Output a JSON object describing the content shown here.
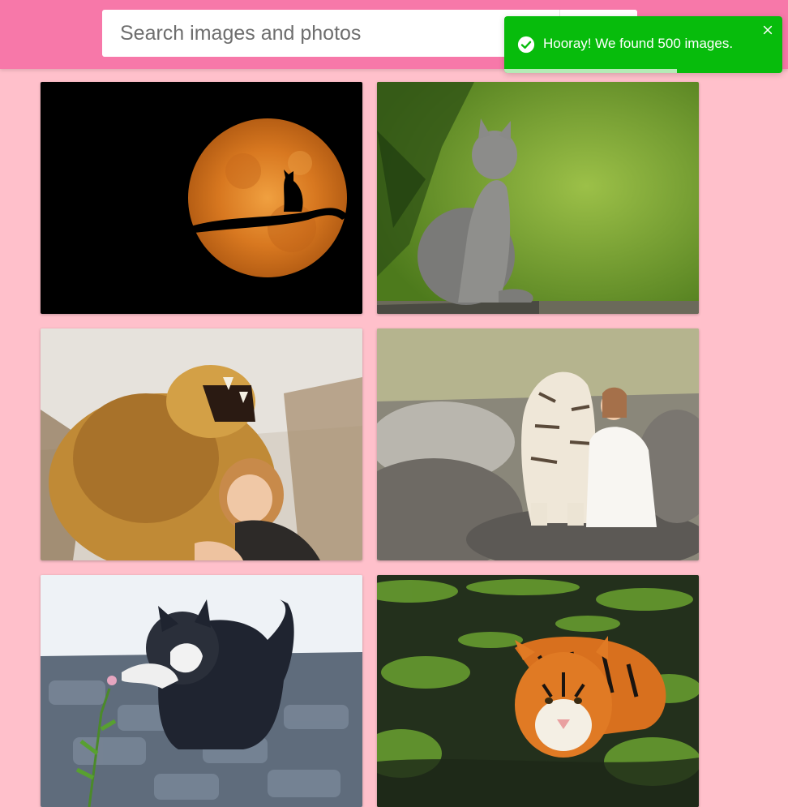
{
  "search": {
    "placeholder": "Search images and photos",
    "value": "",
    "button_icon": "search-icon"
  },
  "toast": {
    "message": "Hooray! We found 500 images.",
    "icon": "check-circle-icon",
    "close_icon": "close-icon",
    "progress_remaining": 0.62,
    "color": "#07bc0c"
  },
  "colors": {
    "header": "#f778a9",
    "background": "#ffc0cb"
  },
  "gallery": {
    "images": [
      {
        "subject": "moon-cat-silhouette"
      },
      {
        "subject": "gray-kitten"
      },
      {
        "subject": "lion-and-girl"
      },
      {
        "subject": "white-tiger-and-woman"
      },
      {
        "subject": "kitten-with-flower"
      },
      {
        "subject": "tiger-in-water"
      }
    ]
  }
}
